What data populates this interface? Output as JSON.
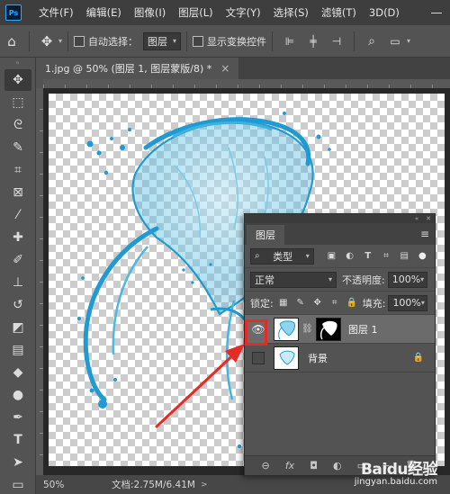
{
  "app": {
    "logo_text": "Ps"
  },
  "menubar": {
    "items": [
      "文件(F)",
      "编辑(E)",
      "图像(I)",
      "图层(L)",
      "文字(Y)",
      "选择(S)",
      "滤镜(T)",
      "3D(D)"
    ],
    "window_controls": [
      "—",
      "□",
      "✕"
    ]
  },
  "options_bar": {
    "auto_select_label": "自动选择：",
    "auto_select_value": "图层",
    "transform_controls_label": "显示变换控件"
  },
  "document": {
    "tab_title": "1.jpg @ 50% (图层 1, 图层蒙版/8) *",
    "tab_close": "×"
  },
  "statusbar": {
    "zoom": "50%",
    "doc_size": "文档:2.75M/6.41M",
    "arrow": ">"
  },
  "layers_panel": {
    "tab_label": "图层",
    "filter_kind": "类型",
    "blend_mode": "正常",
    "opacity_label": "不透明度:",
    "opacity_value": "100%",
    "lock_label": "锁定:",
    "fill_label": "填充:",
    "fill_value": "100%",
    "layers": [
      {
        "name": "图层 1",
        "visible": true,
        "selected": true,
        "has_mask": true
      },
      {
        "name": "背景",
        "visible": false,
        "selected": false,
        "locked": true
      }
    ],
    "footer_icons": [
      "link-icon",
      "fx-icon",
      "mask-icon",
      "adjustment-icon",
      "folder-icon",
      "new-layer-icon",
      "trash-icon"
    ],
    "footer_labels": [
      "⊖",
      "fx",
      "◘",
      "◐",
      "▭",
      "+",
      "🗑"
    ]
  },
  "watermark": {
    "logo": "Baidu经验",
    "sub": "jingyan.baidu.com"
  },
  "colors": {
    "splash": "#1f9bd1",
    "annotation_red": "#e52b25"
  }
}
